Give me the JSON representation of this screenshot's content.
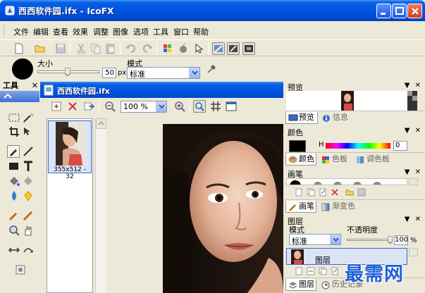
{
  "window": {
    "title": "西西软件园.ifx - IcoFX",
    "icon": "icofx-app-icon"
  },
  "menu": [
    "文件",
    "编辑",
    "查看",
    "效果",
    "调整",
    "图像",
    "选项",
    "工具",
    "窗口",
    "帮助"
  ],
  "options": {
    "size_label": "大小",
    "size_value": "50",
    "size_unit": "px",
    "mode_label": "模式",
    "mode_value": "标准"
  },
  "tools_panel": {
    "title": "工具",
    "close": "✕"
  },
  "document": {
    "title": "西西软件园.ifx",
    "zoom": "100 %",
    "thumbnail_caption": "355x512 - 32"
  },
  "panels": {
    "preview": {
      "title": "预览",
      "tabs": [
        "预览",
        "信息"
      ]
    },
    "color": {
      "title": "颜色",
      "h_label": "H",
      "h_value": "0",
      "tabs": [
        "颜色",
        "色板",
        "调色板"
      ]
    },
    "brush": {
      "title": "画笔",
      "tabs": [
        "画笔",
        "渐变色"
      ]
    },
    "layers": {
      "title": "图层",
      "mode_label": "模式",
      "opacity_label": "不透明度",
      "mode_value": "标准",
      "opacity_value": "100",
      "opacity_unit": "%",
      "layer_name": "图层",
      "tabs": [
        "图层",
        "历史记录"
      ]
    },
    "controls": "▼ ✕"
  },
  "watermark": "最需网",
  "colors": {
    "titlebar": "#0055e5",
    "chrome": "#ece9d8",
    "selection": "#316ac5"
  }
}
